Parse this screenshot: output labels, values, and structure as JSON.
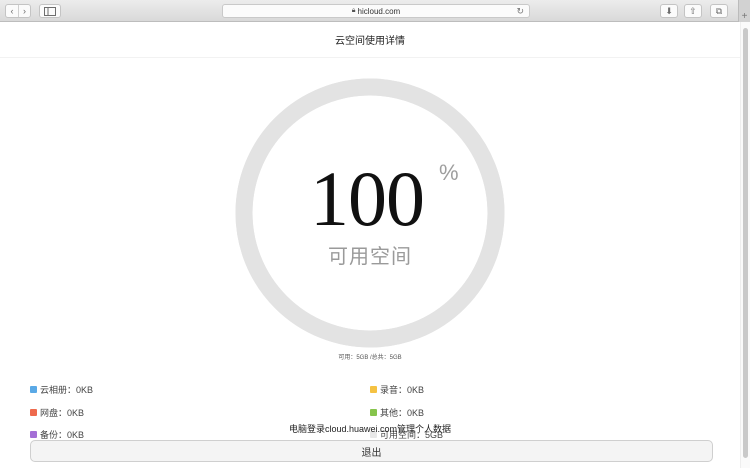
{
  "browser": {
    "address": "hicloud.com",
    "back_icon": "‹",
    "forward_icon": "›",
    "reload_icon": "↻",
    "download_icon": "⬇",
    "share_icon": "⇧",
    "tabs_icon": "⧉",
    "new_tab_icon": "+"
  },
  "page": {
    "title": "云空间使用详情",
    "percent": "100",
    "percent_sign": "%",
    "ring_label": "可用空间",
    "capacity_text": "可用：5GB /总共：5GB",
    "footer_note": "电脑登录cloud.huawei.com管理个人数据",
    "exit_label": "退出",
    "available_fraction": 1.0
  },
  "legend": [
    {
      "label": "云相册：0KB",
      "color": "#5aa9e6"
    },
    {
      "label": "录音：0KB",
      "color": "#f5c242"
    },
    {
      "label": "网盘：0KB",
      "color": "#ee6a4d"
    },
    {
      "label": "其他：0KB",
      "color": "#86c44c"
    },
    {
      "label": "备份：0KB",
      "color": "#a46fd6"
    },
    {
      "label": "可用空间：5GB",
      "color": "#e8e8e8"
    }
  ],
  "colors": {
    "ring_track": "#e6e6e6",
    "ring_fill": "#e3e3e3"
  }
}
